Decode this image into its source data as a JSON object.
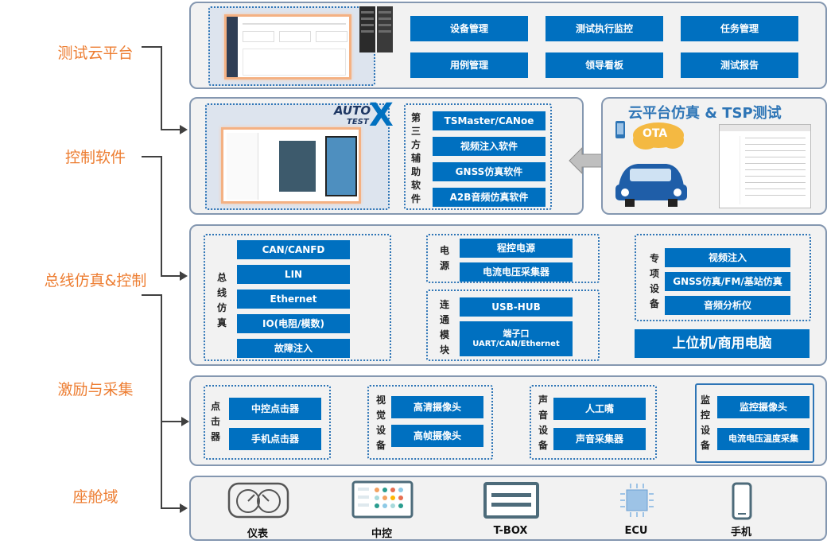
{
  "layers": [
    {
      "label": "测试云平台"
    },
    {
      "label": "控制软件"
    },
    {
      "label": "总线仿真&控制"
    },
    {
      "label": "激励与采集"
    },
    {
      "label": "座舱域"
    }
  ],
  "cloud": {
    "buttons": [
      "设备管理",
      "测试执行监控",
      "任务管理",
      "用例管理",
      "领导看板",
      "测试报告"
    ]
  },
  "control": {
    "logo": {
      "main": "AUTO",
      "sub": "TEST",
      "mark": "X"
    },
    "third_party_label": "第三方辅助软件",
    "third_party_items": [
      "TSMaster/CANoe",
      "视频注入软件",
      "GNSS仿真软件",
      "A2B音频仿真软件"
    ],
    "cloud_sim_title": "云平台仿真 & TSP测试",
    "ota_label": "OTA"
  },
  "bus": {
    "bus_sim_label": "总线仿真",
    "bus_sim_items": [
      "CAN/CANFD",
      "LIN",
      "Ethernet",
      "IO(电阻/模数)",
      "故障注入"
    ],
    "power_label": "电源",
    "power_items": [
      "程控电源",
      "电流电压采集器"
    ],
    "conn_label": "连通模块",
    "conn_items": [
      "USB-HUB",
      "端子口",
      "UART/CAN/Ethernet"
    ],
    "special_label": "专项设备",
    "special_items": [
      "视频注入",
      "GNSS仿真/FM/基站仿真",
      "音频分析仪"
    ],
    "host_pc": "上位机/商用电脑"
  },
  "stimulus": {
    "clicker_label": "点击器",
    "clicker_items": [
      "中控点击器",
      "手机点击器"
    ],
    "vision_label": "视觉设备",
    "vision_items": [
      "高清摄像头",
      "高帧摄像头"
    ],
    "audio_label": "声音设备",
    "audio_items": [
      "人工嘴",
      "声音采集器"
    ],
    "monitor_label": "监控设备",
    "monitor_items": [
      "监控摄像头",
      "电流电压温度采集"
    ]
  },
  "cockpit": {
    "items": [
      {
        "label": "仪表",
        "icon": "gauge-cluster-icon"
      },
      {
        "label": "中控",
        "icon": "center-console-icon"
      },
      {
        "label": "T-BOX",
        "icon": "tbox-icon"
      },
      {
        "label": "ECU",
        "icon": "ecu-chip-icon"
      },
      {
        "label": "手机",
        "icon": "phone-icon"
      }
    ]
  }
}
